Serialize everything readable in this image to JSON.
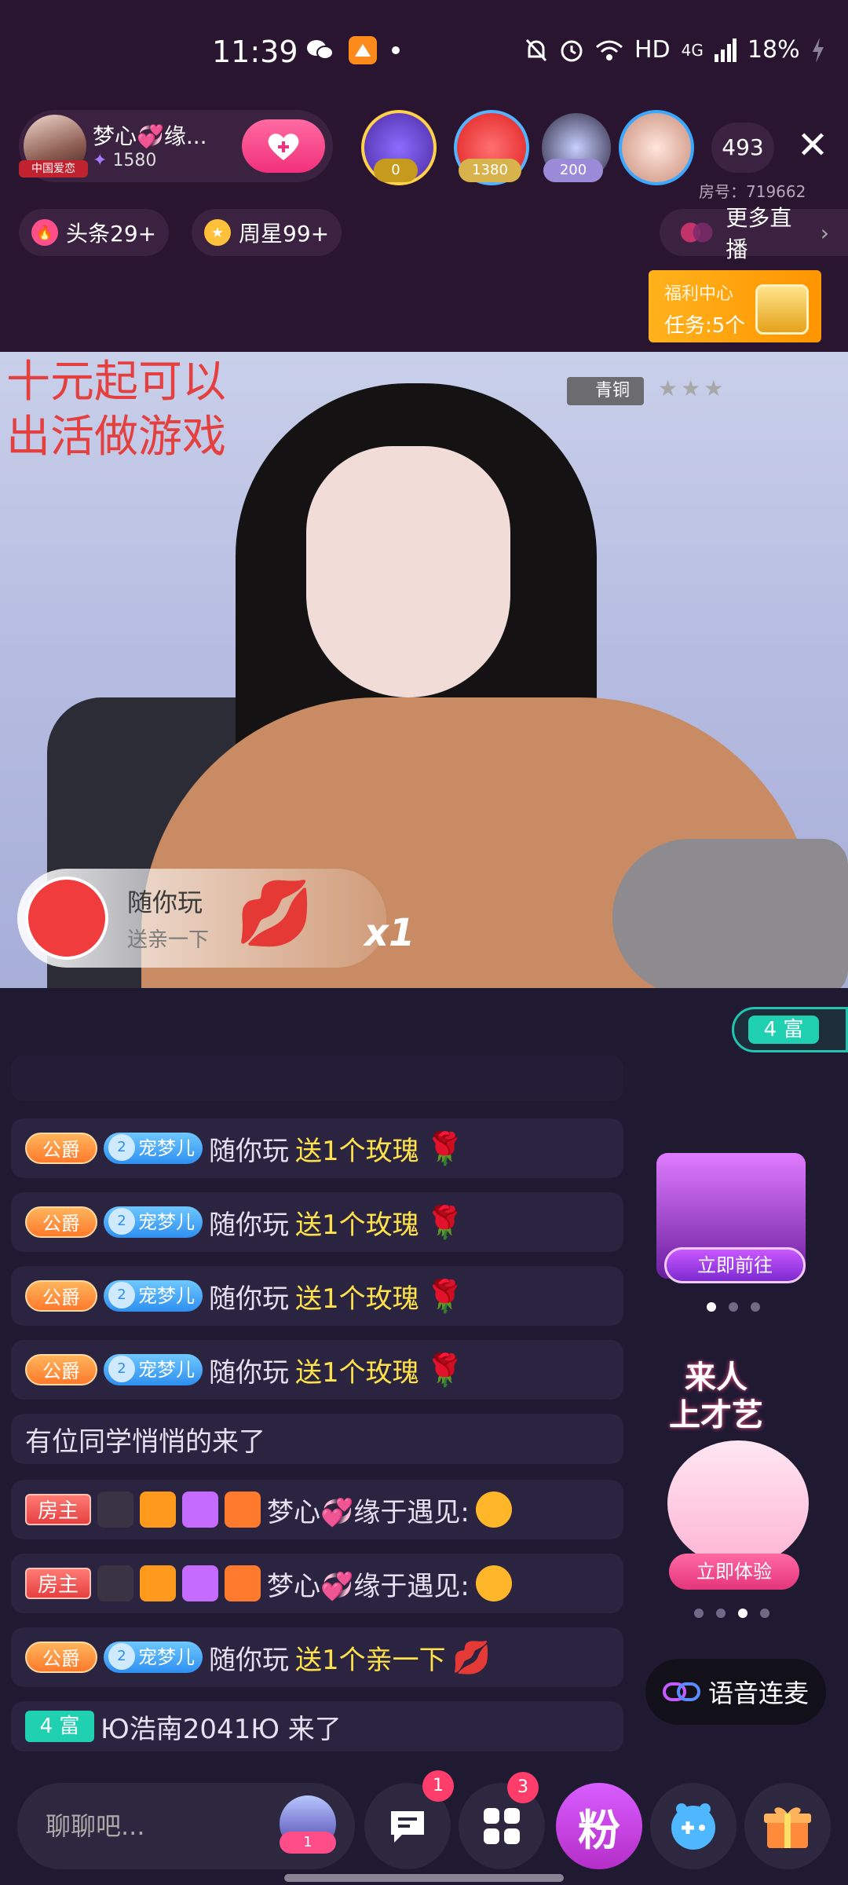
{
  "status_bar": {
    "time": "11:39",
    "right_text": "HD",
    "network": "4G",
    "battery": "18%",
    "icons": [
      "wechat-icon",
      "app-notification-icon",
      "mute-icon",
      "alarm-icon",
      "wifi-icon",
      "signal-icon",
      "battery-charging-icon"
    ]
  },
  "host": {
    "name": "梦心💞缘...",
    "fans": "1580",
    "badge": "中国爱恋"
  },
  "viewers": [
    {
      "badge": "0"
    },
    {
      "badge": "1380"
    },
    {
      "badge": "200"
    },
    {
      "badge": ""
    }
  ],
  "viewer_count": "493",
  "room_no": "房号：719662",
  "tags": {
    "headline": "头条29+",
    "weekstar": "周星99+",
    "more_live": "更多直播"
  },
  "welfare": {
    "title": "福利中心",
    "tasks": "任务:5个"
  },
  "video": {
    "promo_line1": "十元起可以",
    "promo_line2": "出活做游戏",
    "rank": "青铜",
    "rank_stars": "★★★"
  },
  "gift_toast": {
    "user": "随你玩",
    "action": "送亲一下",
    "count": "x1"
  },
  "rich_pill": "4 富",
  "chat": [
    {
      "type": "gift",
      "badge": "公爵",
      "pet": "宠梦儿",
      "pet_level": "2",
      "user": "随你玩",
      "text": "送1个玫瑰",
      "gift": "🌹"
    },
    {
      "type": "gift",
      "badge": "公爵",
      "pet": "宠梦儿",
      "pet_level": "2",
      "user": "随你玩",
      "text": "送1个玫瑰",
      "gift": "🌹"
    },
    {
      "type": "gift",
      "badge": "公爵",
      "pet": "宠梦儿",
      "pet_level": "2",
      "user": "随你玩",
      "text": "送1个玫瑰",
      "gift": "🌹"
    },
    {
      "type": "gift",
      "badge": "公爵",
      "pet": "宠梦儿",
      "pet_level": "2",
      "user": "随你玩",
      "text": "送1个玫瑰",
      "gift": "🌹"
    },
    {
      "type": "system",
      "text": "有位同学悄悄的来了"
    },
    {
      "type": "host",
      "badge": "房主",
      "user": "梦心💞缘于遇见:"
    },
    {
      "type": "host",
      "badge": "房主",
      "user": "梦心💞缘于遇见:"
    },
    {
      "type": "gift",
      "badge": "公爵",
      "pet": "宠梦儿",
      "pet_level": "2",
      "user": "随你玩",
      "text": "送1个亲一下",
      "gift": "💋"
    },
    {
      "type": "enter",
      "badge": "4 富",
      "text": "Ю浩南2041Ю 来了"
    }
  ],
  "side": {
    "event_btn": "立即前往",
    "talent_title_1": "来人",
    "talent_title_2": "上才艺",
    "talent_btn": "立即体验",
    "voice_btn": "语音连麦"
  },
  "bottom": {
    "input_placeholder": "聊聊吧...",
    "avatar_badge": "1",
    "msg_badge": "1",
    "apps_badge": "3",
    "fan_label": "粉"
  },
  "colors": {
    "background": "#2a1530",
    "chat_bg": "#1f1932",
    "gift_text": "#ffe24a",
    "accent_pink": "#f2317a",
    "rich_teal": "#1fd1b0"
  }
}
